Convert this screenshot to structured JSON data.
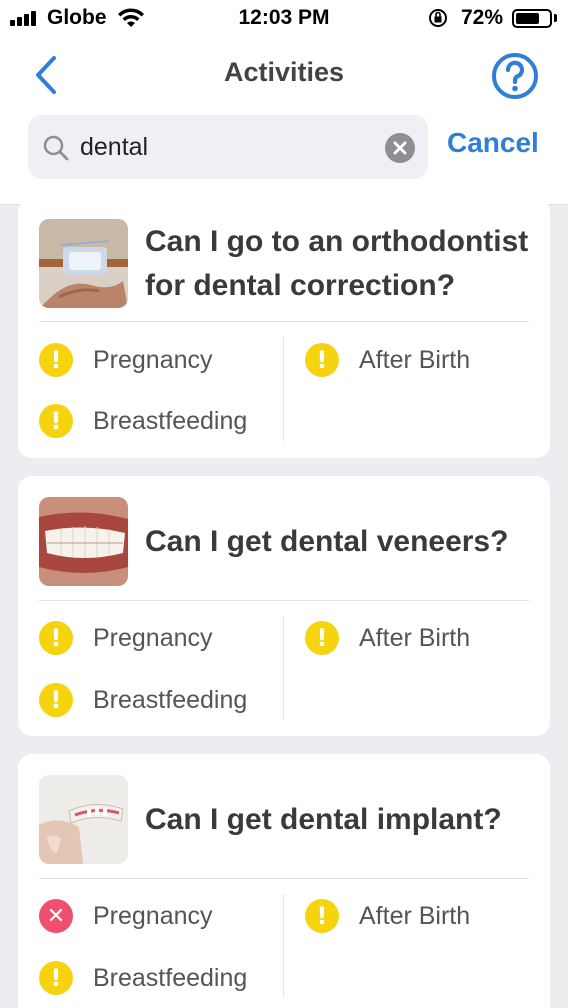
{
  "status_bar": {
    "carrier": "Globe",
    "time": "12:03 PM",
    "battery_percent_text": "72%",
    "battery_level": 0.72
  },
  "nav": {
    "title": "Activities",
    "back_icon": "chevron-left-icon",
    "help_icon": "question-circle-icon"
  },
  "search": {
    "value": "dental",
    "cancel_label": "Cancel"
  },
  "colors": {
    "accent": "#2f7fd8",
    "warning": "#f5d30f",
    "danger": "#f0506e"
  },
  "cards": [
    {
      "title": "Can I go to an orthodontist for dental correction?",
      "image": "orthodontist-photo",
      "statuses": [
        {
          "label": "Pregnancy",
          "status": "caution"
        },
        {
          "label": "After Birth",
          "status": "caution"
        },
        {
          "label": "Breastfeeding",
          "status": "caution"
        }
      ]
    },
    {
      "title": "Can I get dental veneers?",
      "image": "veneers-photo",
      "statuses": [
        {
          "label": "Pregnancy",
          "status": "caution"
        },
        {
          "label": "After Birth",
          "status": "caution"
        },
        {
          "label": "Breastfeeding",
          "status": "caution"
        }
      ]
    },
    {
      "title": "Can I get dental implant?",
      "image": "implant-photo",
      "statuses": [
        {
          "label": "Pregnancy",
          "status": "not-allowed"
        },
        {
          "label": "After Birth",
          "status": "caution"
        },
        {
          "label": "Breastfeeding",
          "status": "caution"
        }
      ]
    }
  ]
}
